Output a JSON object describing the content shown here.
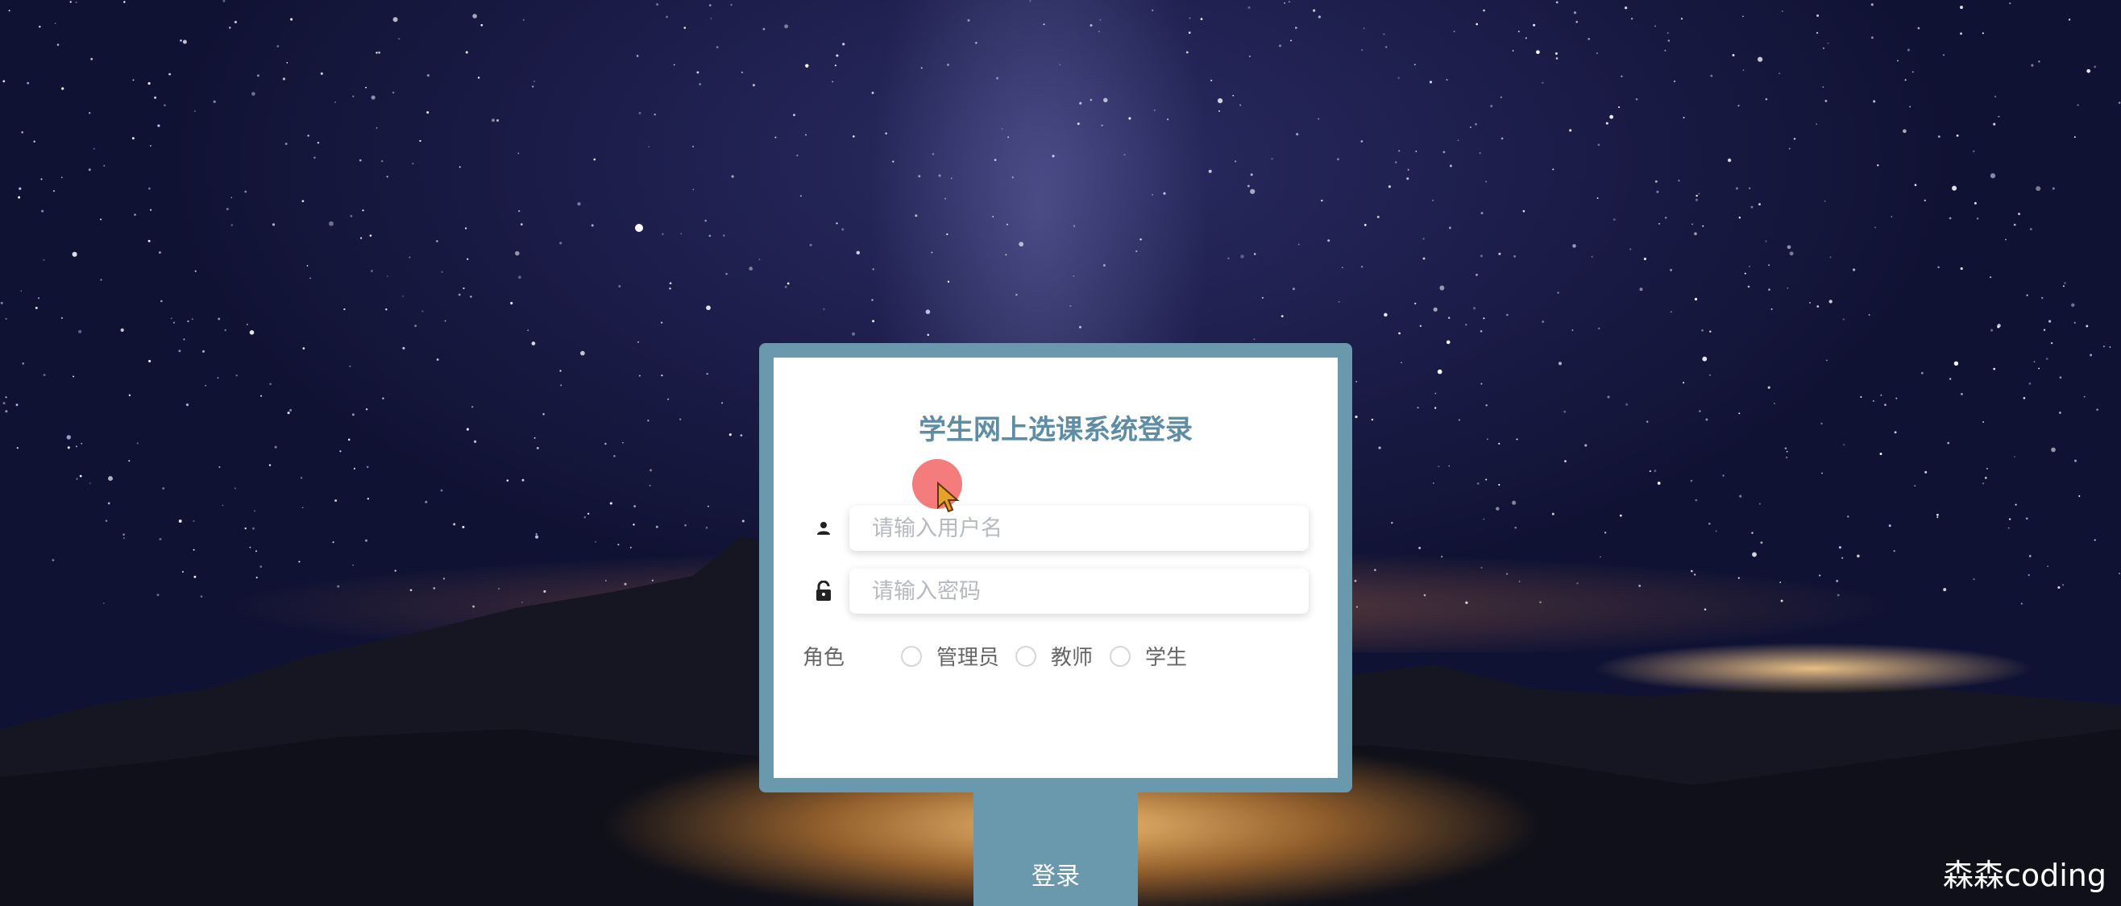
{
  "login": {
    "title": "学生网上选课系统登录",
    "username": {
      "placeholder": "请输入用户名",
      "value": ""
    },
    "password": {
      "placeholder": "请输入密码",
      "value": ""
    },
    "role": {
      "label": "角色",
      "options": [
        "管理员",
        "教师",
        "学生"
      ],
      "selected": null
    },
    "submit_label": "登录"
  },
  "icons": {
    "username": "user-icon",
    "password": "lock-icon"
  },
  "colors": {
    "accent": "#6a98ad",
    "title": "#5f8ea4",
    "panel_bg": "#ffffff",
    "placeholder": "#b5b9c0",
    "cursor_halo": "#f05050"
  },
  "watermark": "森森coding"
}
